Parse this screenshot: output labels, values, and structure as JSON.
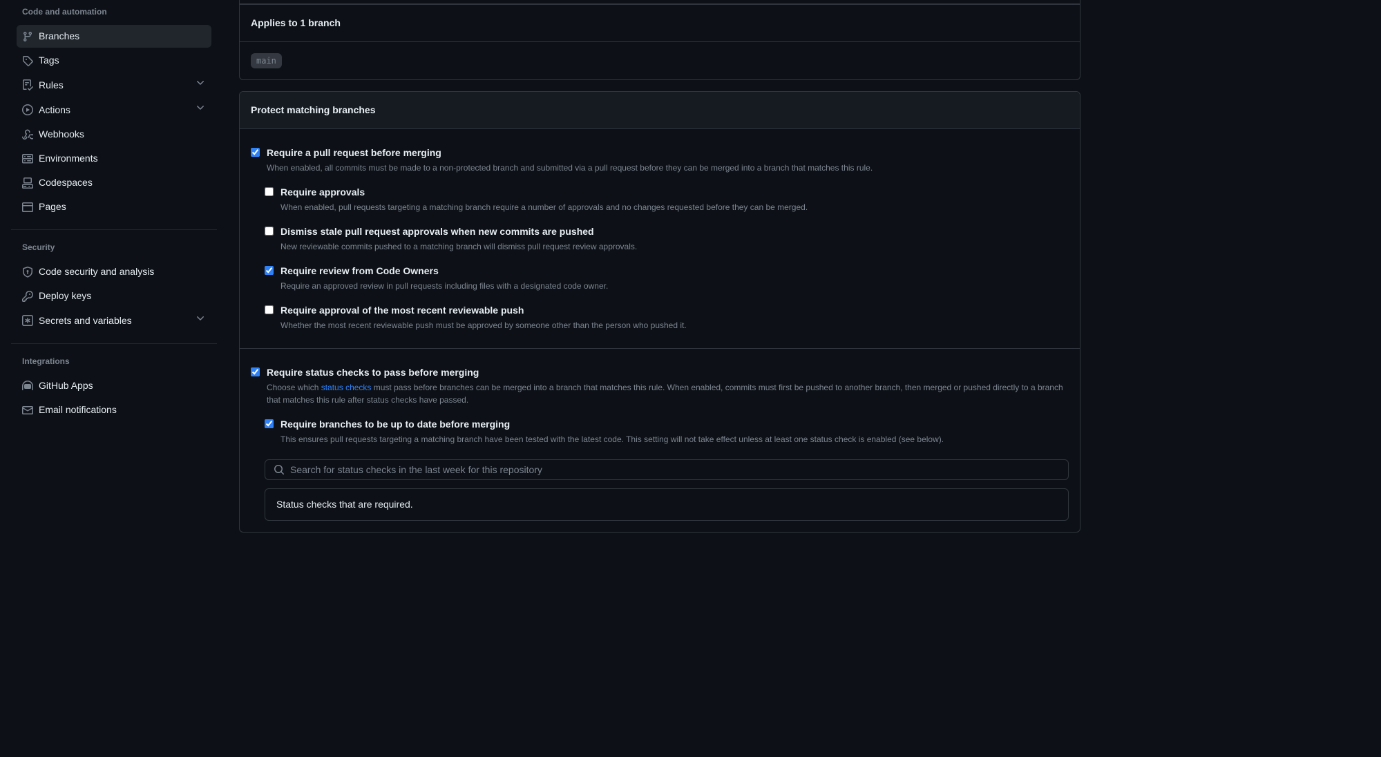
{
  "sidebar": {
    "sections": {
      "code_automation": {
        "title": "Code and automation",
        "items": [
          {
            "label": "Branches",
            "icon": "git-branch-icon"
          },
          {
            "label": "Tags",
            "icon": "tag-icon"
          },
          {
            "label": "Rules",
            "icon": "checklist-icon"
          },
          {
            "label": "Actions",
            "icon": "play-icon"
          },
          {
            "label": "Webhooks",
            "icon": "webhook-icon"
          },
          {
            "label": "Environments",
            "icon": "server-icon"
          },
          {
            "label": "Codespaces",
            "icon": "codespaces-icon"
          },
          {
            "label": "Pages",
            "icon": "browser-icon"
          }
        ]
      },
      "security": {
        "title": "Security",
        "items": [
          {
            "label": "Code security and analysis",
            "icon": "shield-icon"
          },
          {
            "label": "Deploy keys",
            "icon": "key-icon"
          },
          {
            "label": "Secrets and variables",
            "icon": "key-asterisk-icon"
          }
        ]
      },
      "integrations": {
        "title": "Integrations",
        "items": [
          {
            "label": "GitHub Apps",
            "icon": "hubot-icon"
          },
          {
            "label": "Email notifications",
            "icon": "mail-icon"
          }
        ]
      }
    }
  },
  "main": {
    "applies_to": {
      "title": "Applies to 1 branch",
      "branch": "main"
    },
    "protect": {
      "header": "Protect matching branches",
      "rules": {
        "require_pr": {
          "title": "Require a pull request before merging",
          "desc": "When enabled, all commits must be made to a non-protected branch and submitted via a pull request before they can be merged into a branch that matches this rule.",
          "sub": {
            "approvals": {
              "title": "Require approvals",
              "desc": "When enabled, pull requests targeting a matching branch require a number of approvals and no changes requested before they can be merged."
            },
            "dismiss_stale": {
              "title": "Dismiss stale pull request approvals when new commits are pushed",
              "desc": "New reviewable commits pushed to a matching branch will dismiss pull request review approvals."
            },
            "code_owners": {
              "title": "Require review from Code Owners",
              "desc": "Require an approved review in pull requests including files with a designated code owner."
            },
            "recent_push": {
              "title": "Require approval of the most recent reviewable push",
              "desc": "Whether the most recent reviewable push must be approved by someone other than the person who pushed it."
            }
          }
        },
        "status_checks": {
          "title": "Require status checks to pass before merging",
          "desc_prefix": "Choose which ",
          "desc_link": "status checks",
          "desc_suffix": " must pass before branches can be merged into a branch that matches this rule. When enabled, commits must first be pushed to another branch, then merged or pushed directly to a branch that matches this rule after status checks have passed.",
          "sub": {
            "up_to_date": {
              "title": "Require branches to be up to date before merging",
              "desc": "This ensures pull requests targeting a matching branch have been tested with the latest code. This setting will not take effect unless at least one status check is enabled (see below)."
            }
          },
          "search_placeholder": "Search for status checks in the last week for this repository",
          "required_label": "Status checks that are required."
        }
      }
    }
  }
}
